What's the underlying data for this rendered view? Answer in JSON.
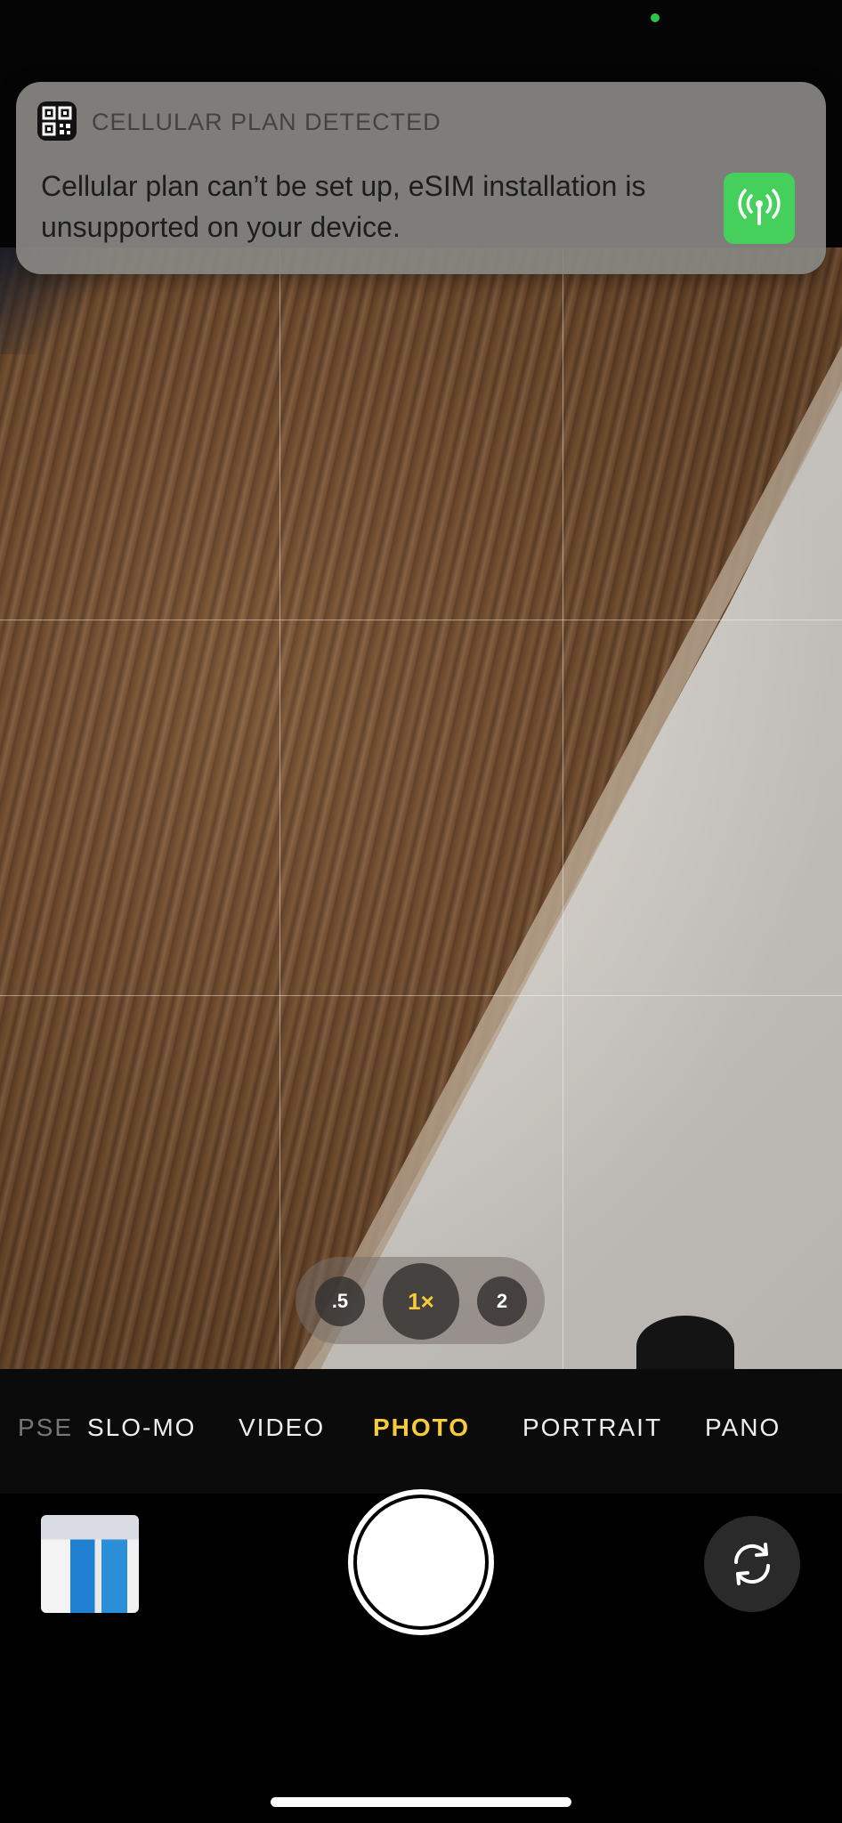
{
  "notification": {
    "app_icon": "qr-code-icon",
    "title": "CELLULAR PLAN DETECTED",
    "body": "Cellular plan can’t be set up, eSIM installation is unsupported on your device.",
    "thumbnail_icon": "cellular-antenna-icon",
    "thumbnail_color": "#45d05b"
  },
  "zoom": {
    "options": [
      ".5",
      "1×",
      "2"
    ],
    "selected": "1×",
    "selected_color": "#f7cc3a"
  },
  "modes": {
    "items": [
      "PSE",
      "SLO-MO",
      "VIDEO",
      "PHOTO",
      "PORTRAIT",
      "PANO"
    ],
    "selected": "PHOTO"
  },
  "controls": {
    "last_photo_icon": "photo-thumbnail",
    "shutter_icon": "shutter-icon",
    "flip_icon": "camera-flip-icon"
  },
  "indicators": {
    "camera_in_use_color": "#30c24a"
  }
}
